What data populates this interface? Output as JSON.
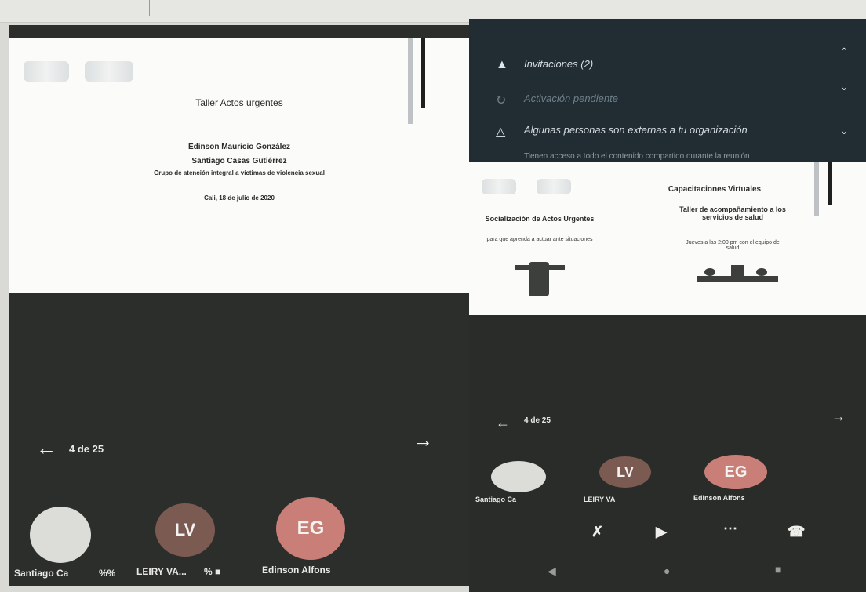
{
  "left_screen": {
    "slide": {
      "title": "Taller Actos urgentes",
      "author1": "Edinson Mauricio González",
      "author2": "Santiago Casas Gutiérrez",
      "group": "Grupo de atención integral a víctimas de violencia sexual",
      "date": "Cali, 18 de julio de 2020"
    },
    "pager": {
      "text": "4 de 25",
      "prev_icon": "arrow-left-icon",
      "next_icon": "arrow-right-icon"
    },
    "participants": [
      {
        "initials": "",
        "name": "Santiago Ca",
        "badge": "%%",
        "color": "#dcdcd8"
      },
      {
        "initials": "LV",
        "name": "LEIRY VA...",
        "badge": "% ■",
        "color": "#7b5a52"
      },
      {
        "initials": "EG",
        "name": "Edinson Alfons",
        "badge": "",
        "color": "#c97f78"
      }
    ]
  },
  "right_screen": {
    "notifications": [
      {
        "icon": "bell-icon",
        "text": "Invitaciones (2)",
        "subtext": ""
      },
      {
        "icon": "sync-icon",
        "text": "Activación pendiente",
        "subtext": ""
      },
      {
        "icon": "warning-icon",
        "text": "Algunas personas son externas a tu organización",
        "subtext": "Tienen acceso a todo el contenido compartido durante la reunión"
      }
    ],
    "slide": {
      "title": "Capacitaciones Virtuales",
      "left_heading": "Socialización de Actos Urgentes",
      "left_sub": "para que aprenda a actuar ante situaciones",
      "right_heading": "Taller de acompañamiento a los servicios de salud",
      "right_sub": "Jueves a las 2:00 pm con el equipo de salud"
    },
    "pager": {
      "text": "4 de 25"
    },
    "participants": [
      {
        "initials": "",
        "name": "Santiago Ca"
      },
      {
        "initials": "LV",
        "name": "LEIRY VA"
      },
      {
        "initials": "EG",
        "name": "Edinson Alfons"
      }
    ],
    "controls": [
      "mic-off-icon",
      "speaker-icon",
      "more-icon",
      "hangup-icon"
    ],
    "system_nav": [
      "back-icon",
      "home-icon",
      "recents-icon"
    ]
  }
}
